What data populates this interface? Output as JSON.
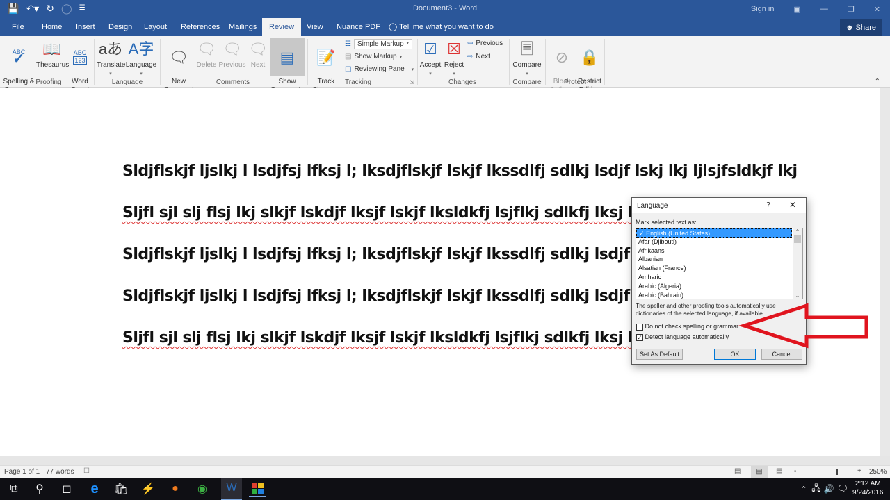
{
  "window": {
    "title": "Document3 - Word",
    "sign_in": "Sign in",
    "share": "Share"
  },
  "qat": {
    "save": "save-icon",
    "undo": "undo-icon",
    "redo": "redo-icon"
  },
  "tabs": [
    "File",
    "Home",
    "Insert",
    "Design",
    "Layout",
    "References",
    "Mailings",
    "Review",
    "View",
    "Nuance PDF"
  ],
  "active_tab": "Review",
  "tell_me": "Tell me what you want to do",
  "ribbon": {
    "proofing": {
      "label": "Proofing",
      "spelling": "Spelling &\nGrammar",
      "thesaurus": "Thesaurus",
      "word_count": "Word\nCount"
    },
    "language": {
      "label": "Language",
      "translate": "Translate",
      "language": "Language"
    },
    "comments": {
      "label": "Comments",
      "new": "New\nComment",
      "delete": "Delete",
      "previous": "Previous",
      "next": "Next",
      "show": "Show\nComments"
    },
    "tracking": {
      "label": "Tracking",
      "track": "Track\nChanges",
      "markup_select": "Simple Markup",
      "show_markup": "Show Markup",
      "reviewing_pane": "Reviewing Pane"
    },
    "changes": {
      "label": "Changes",
      "accept": "Accept",
      "reject": "Reject",
      "previous": "Previous",
      "next": "Next"
    },
    "compare": {
      "label": "Compare",
      "compare": "Compare"
    },
    "protect": {
      "label": "Protect",
      "block": "Block\nAuthors",
      "restrict": "Restrict\nEditing"
    }
  },
  "document": {
    "lines": [
      {
        "text": "Sldjflskjf ljslkj l lsdjfsj lfksj l; lksdjflskjf lskjf lkssdlfj sdlkj lsdjf lskj lkj ljlsjfsldkjf lkj",
        "squiggly": false
      },
      {
        "text": "Sljfl sjl slj flsj lkj slkjf lskdjf lksjf lskjf lksldkfj lsjflkj sdlkfj lksj ll",
        "squiggly": true
      },
      {
        "text": "Sldjflskjf ljslkj l lsdjfsj lfksj l; lksdjflskjf lskjf lkssdlfj sdlkj lsdjf",
        "squiggly": false
      },
      {
        "text": "Sldjflskjf ljslkj l lsdjfsj lfksj l; lksdjflskjf lskjf lkssdlfj sdlkj lsdjf",
        "squiggly": false
      },
      {
        "text": "Sljfl sjl slj flsj lkj slkjf lskdjf lksjf lskjf lksldkfj lsjflkj sdlkfj lksj ll",
        "squiggly": true
      }
    ]
  },
  "dialog": {
    "title": "Language",
    "help": "?",
    "mark_label": "Mark selected text as:",
    "languages": [
      "English (United States)",
      "Afar (Djibouti)",
      "Afrikaans",
      "Albanian",
      "Alsatian (France)",
      "Amharic",
      "Arabic (Algeria)",
      "Arabic (Bahrain)"
    ],
    "selected_language": "English (United States)",
    "info": "The speller and other proofing tools automatically use dictionaries of the selected language, if available.",
    "no_check_label": "Do not check spelling or grammar",
    "no_check_checked": false,
    "detect_label": "Detect language automatically",
    "detect_checked": true,
    "set_default": "Set As Default",
    "ok": "OK",
    "cancel": "Cancel"
  },
  "annotation": {
    "type": "arrow",
    "color": "#e0141e",
    "points_to": "no_check_label"
  },
  "status": {
    "page": "Page 1 of 1",
    "words": "77 words",
    "zoom": "250%"
  },
  "taskbar": {
    "time": "2:12 AM",
    "date": "9/24/2016"
  }
}
